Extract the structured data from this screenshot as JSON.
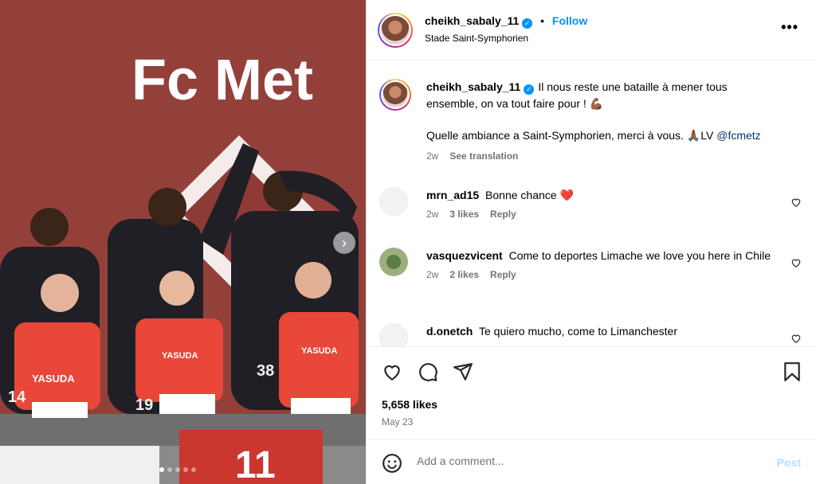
{
  "post": {
    "username": "cheikh_sabaly_11",
    "verified_mark": "✓",
    "separator": "•",
    "follow_label": "Follow",
    "location": "Stade Saint-Symphorien",
    "more_label": "•••"
  },
  "photo": {
    "banner_text": "Fc Met",
    "bottom_banner_text": "11",
    "jersey_sponsor": "YASUDA",
    "numbers": [
      "14",
      "19",
      "38"
    ],
    "carousel_next": "›",
    "dots_total": 5,
    "dots_active": 0
  },
  "caption": {
    "username": "cheikh_sabaly_11",
    "line1": "Il nous reste une bataille à mener tous ensemble, on va tout faire pour ! 💪🏾",
    "line2": "Quelle ambiance a Saint-Symphorien, merci à vous. 🙏🏾LV",
    "mention": "@fcmetz",
    "time": "2w",
    "see_translation": "See translation"
  },
  "comments": [
    {
      "username": "mrn_ad15",
      "text": "Bonne chance ❤️",
      "time": "2w",
      "likes": "3 likes",
      "reply": "Reply"
    },
    {
      "username": "vasquezvicent",
      "text": "Come to deportes Limache we love you here in Chile",
      "time": "2w",
      "likes": "2 likes",
      "reply": "Reply"
    },
    {
      "username": "d.onetch",
      "text": "Te quiero mucho, come to Limanchester",
      "time": "",
      "likes": "",
      "reply": ""
    }
  ],
  "actions": {
    "likes": "5,658 likes",
    "date": "May 23"
  },
  "add_comment": {
    "placeholder": "Add a comment...",
    "post_label": "Post"
  }
}
